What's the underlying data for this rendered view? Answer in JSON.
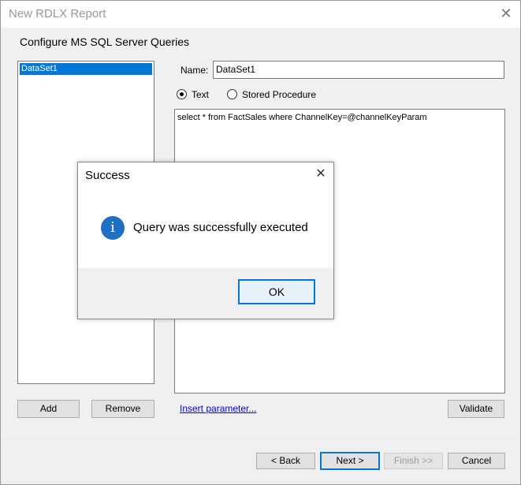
{
  "window": {
    "title": "New RDLX Report",
    "close_glyph": "✕"
  },
  "header": {
    "subtitle": "Configure MS SQL Server Queries"
  },
  "datasets": {
    "items": [
      "DataSet1"
    ],
    "selected": "DataSet1"
  },
  "form": {
    "name_label": "Name:",
    "name_value": "DataSet1",
    "radio_text": "Text",
    "radio_stored": "Stored Procedure",
    "query": "select * from FactSales where ChannelKey=@channelKeyParam"
  },
  "buttons": {
    "add": "Add",
    "remove": "Remove",
    "insert_param": "Insert parameter...",
    "validate": "Validate",
    "back": "< Back",
    "next": "Next >",
    "finish": "Finish >>",
    "cancel": "Cancel"
  },
  "dialog": {
    "title": "Success",
    "message": "Query was successfully executed",
    "ok": "OK",
    "close_glyph": "✕",
    "icon_glyph": "i"
  },
  "colors": {
    "accent": "#0078d7",
    "info_icon": "#1f6fc5",
    "link": "#0000ee"
  }
}
